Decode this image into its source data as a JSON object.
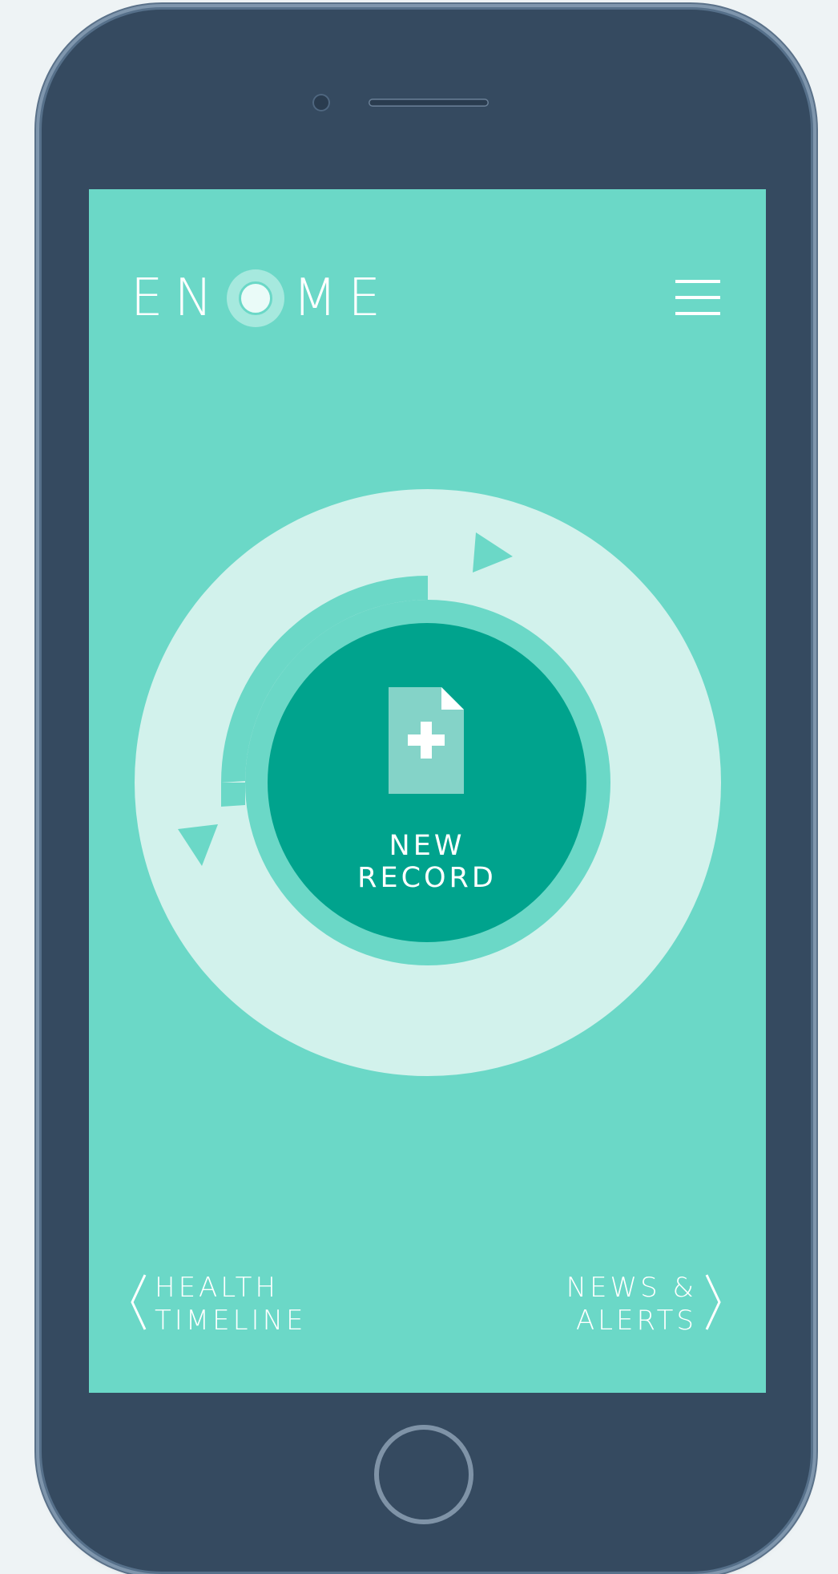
{
  "app": {
    "logo_text_left": "E",
    "logo_text_mid": "N",
    "logo_text_right": "ME",
    "menu_icon": "hamburger-menu-icon"
  },
  "main": {
    "primary_action": {
      "line1": "NEW",
      "line2": "RECORD",
      "icon": "add-document-icon"
    }
  },
  "bottom_nav": {
    "left": {
      "line1": "HEALTH",
      "line2": "TIMELINE",
      "icon": "chevron-left-icon"
    },
    "right": {
      "line1": "NEWS &",
      "line2": "ALERTS",
      "icon": "chevron-right-icon"
    }
  },
  "colors": {
    "screen_bg": "#6bd8c7",
    "outer_ring": "#d2f2ec",
    "inner_button": "#00a38d",
    "phone_body": "#354a60"
  }
}
